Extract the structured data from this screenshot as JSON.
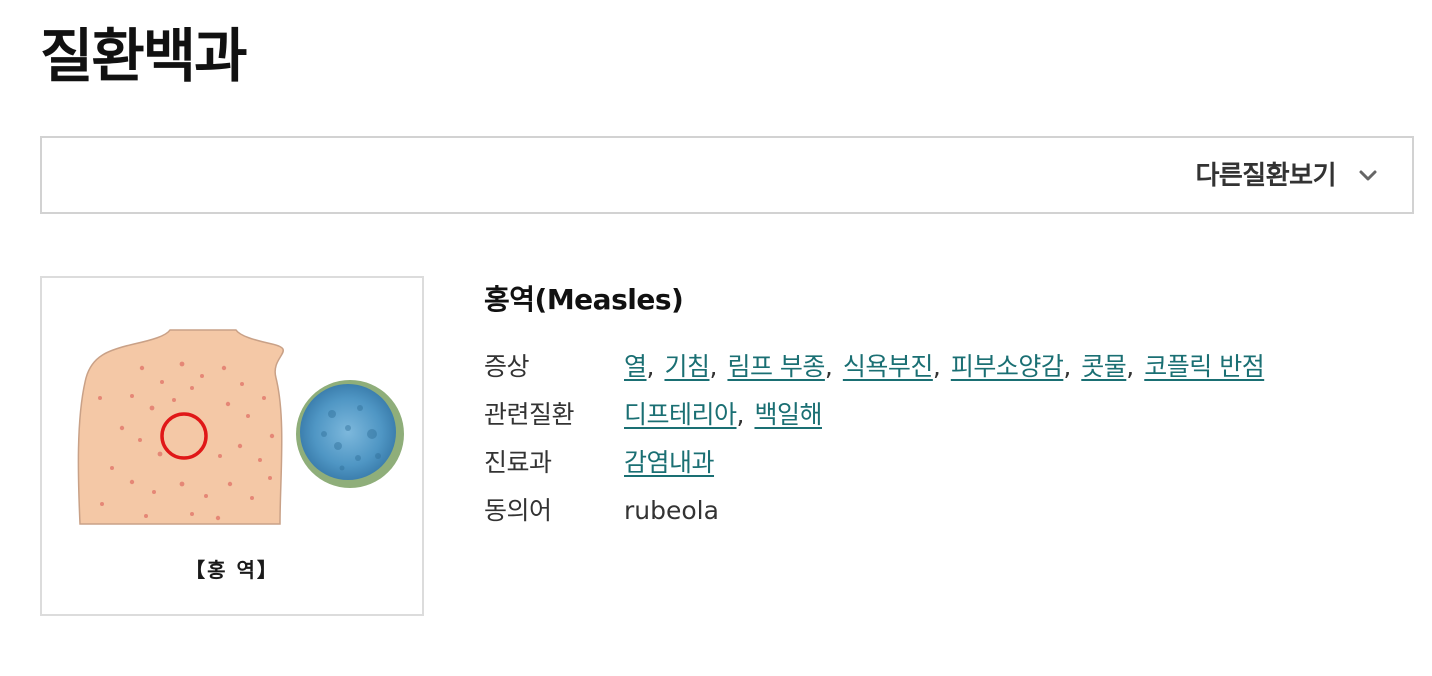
{
  "page_title": "질환백과",
  "selector": {
    "label": "다른질환보기",
    "icon": "chevron-down-icon"
  },
  "image": {
    "caption": "【홍 역】",
    "colors": {
      "skin": "#f4c8a6",
      "rash": "#d9534f",
      "circle": "#e01818",
      "virus_outer": "#8fae7a",
      "virus_inner": "#5aa3cf"
    }
  },
  "disease": {
    "title": "홍역(Measles)"
  },
  "info": {
    "symptoms": {
      "label": "증상",
      "items": [
        "열",
        "기침",
        "림프 부종",
        "식욕부진",
        "피부소양감",
        "콧물",
        "코플릭 반점"
      ]
    },
    "related": {
      "label": "관련질환",
      "items": [
        "디프테리아",
        "백일해"
      ]
    },
    "department": {
      "label": "진료과",
      "items": [
        "감염내과"
      ]
    },
    "synonym": {
      "label": "동의어",
      "value": "rubeola"
    }
  },
  "colors": {
    "link": "#1a6f73",
    "border": "#d2d2d2",
    "text": "#333333"
  }
}
